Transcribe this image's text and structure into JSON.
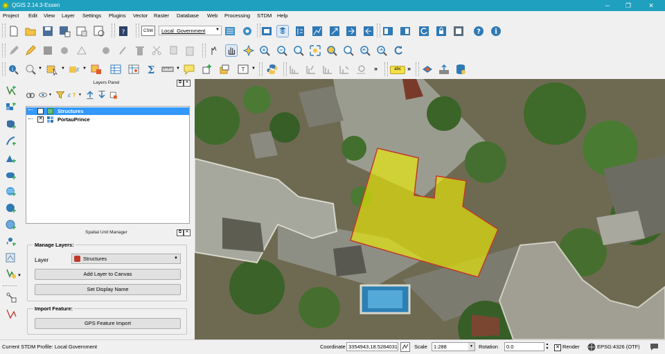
{
  "window": {
    "title": "QGIS 2.14.3-Essen",
    "minimize_glyph": "─",
    "maximize_glyph": "❐",
    "close_glyph": "✕"
  },
  "menubar": {
    "items": [
      "Project",
      "Edit",
      "View",
      "Layer",
      "Settings",
      "Plugins",
      "Vector",
      "Raster",
      "Database",
      "Web",
      "Processing",
      "STDM",
      "Help"
    ]
  },
  "toolbar": {
    "csw_label": "CSW",
    "profile_combo_value": "Local_Government",
    "label_tool_text": "abc"
  },
  "layers_panel": {
    "title": "Layers Panel",
    "layers": [
      {
        "name": "Structures",
        "checked": true,
        "selected": true
      },
      {
        "name": "PortauPrince",
        "checked": true,
        "selected": false
      }
    ]
  },
  "spatial_unit_manager": {
    "title": "Spatial Unit Manager",
    "manage_layers_label": "Manage Layers:",
    "layer_label": "Layer",
    "layer_value": "Structures",
    "add_layer_button": "Add Layer to Canvas",
    "set_display_name_button": "Set Display Name",
    "import_feature_label": "Import Feature:",
    "gps_import_button": "GPS Feature Import"
  },
  "statusbar": {
    "profile_text": "Current STDM Profile: Local Government",
    "coordinate_label": "Coordinate",
    "coordinate_value": "3354943,18.5284031",
    "scale_label": "Scale",
    "scale_value": "1:288",
    "rotation_label": "Rotation",
    "rotation_value": "0.0",
    "render_label": "Render",
    "crs_label": "EPSG:4326 (OTF)"
  },
  "colors": {
    "titlebar": "#1fa0bf",
    "selection": "#3399ff",
    "polygon_fill": "#f0f000",
    "polygon_stroke": "#c0392b"
  }
}
